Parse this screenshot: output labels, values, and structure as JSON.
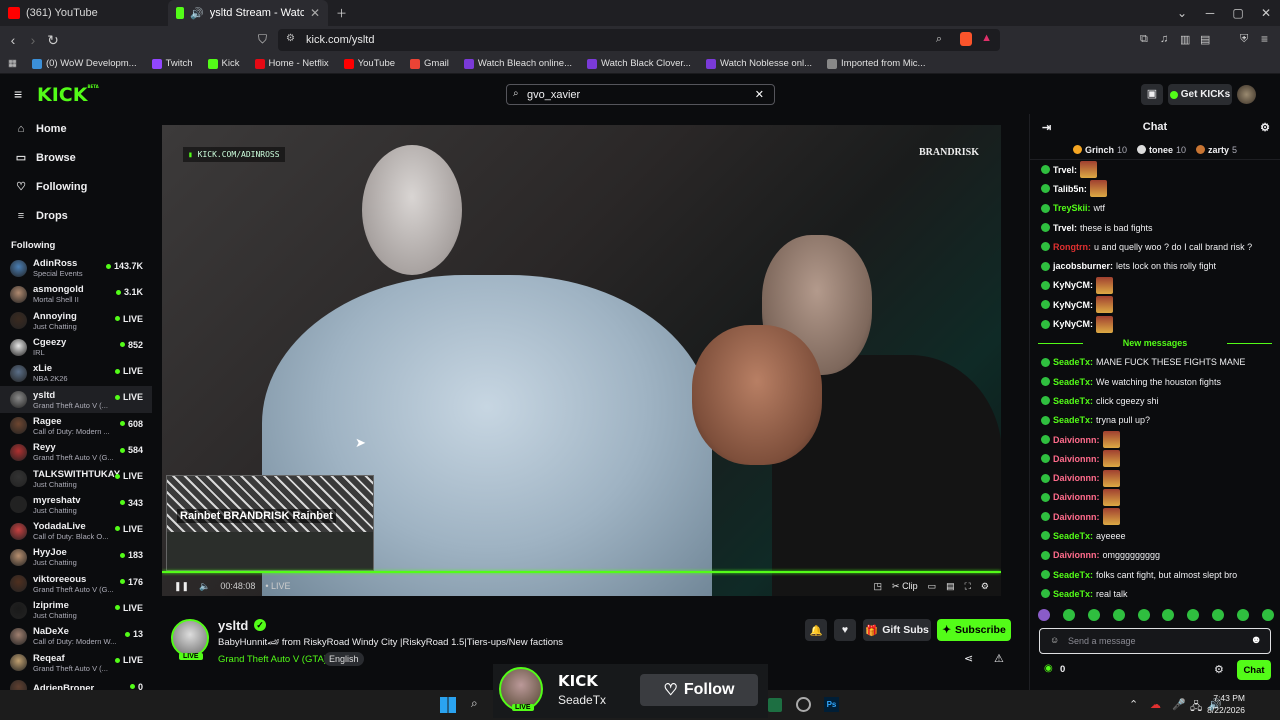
{
  "browser": {
    "tabs": [
      {
        "label": "(361) YouTube",
        "color": "#ff0000"
      },
      {
        "label": "ysltd Stream - Watch Live on",
        "color": "#53fc18"
      }
    ],
    "url": "kick.com/ysltd",
    "bookmarks": [
      {
        "label": "(0) WoW Developm...",
        "color": "#3b8fd8"
      },
      {
        "label": "Twitch",
        "color": "#9146ff"
      },
      {
        "label": "Kick",
        "color": "#53fc18"
      },
      {
        "label": "Home - Netflix",
        "color": "#e50914"
      },
      {
        "label": "YouTube",
        "color": "#ff0000"
      },
      {
        "label": "Gmail",
        "color": "#ea4335"
      },
      {
        "label": "Watch Bleach online...",
        "color": "#7a3ad8"
      },
      {
        "label": "Watch Black Clover...",
        "color": "#7a3ad8"
      },
      {
        "label": "Watch Noblesse onl...",
        "color": "#7a3ad8"
      },
      {
        "label": "Imported from Mic...",
        "color": "#888888"
      }
    ]
  },
  "header": {
    "logo": "KICK",
    "logo_sup": "BETA",
    "search_value": "gvo_xavier",
    "get_kicks": "Get KICKs"
  },
  "sidebar": {
    "nav": [
      {
        "label": "Home",
        "icon": "⌂"
      },
      {
        "label": "Browse",
        "icon": "▭"
      },
      {
        "label": "Following",
        "icon": "♡"
      },
      {
        "label": "Drops",
        "icon": "≡"
      }
    ],
    "following_title": "Following",
    "channels": [
      {
        "name": "AdinRoss",
        "cat": "Special Events",
        "count": "143.7K",
        "color": "#4a7fb5"
      },
      {
        "name": "asmongold",
        "cat": "Mortal Shell II",
        "count": "3.1K",
        "color": "#b08a70"
      },
      {
        "name": "Annoying",
        "cat": "Just Chatting",
        "count": "LIVE",
        "color": "#3a2a20"
      },
      {
        "name": "Cgeezy",
        "cat": "IRL",
        "count": "852",
        "color": "#e8e8e8"
      },
      {
        "name": "xLie",
        "cat": "NBA 2K26",
        "count": "LIVE",
        "color": "#5b6f88"
      },
      {
        "name": "ysltd",
        "cat": "Grand Theft Auto V (...",
        "count": "LIVE",
        "color": "#8b8b8b"
      },
      {
        "name": "Ragee",
        "cat": "Call of Duty: Modern ...",
        "count": "608",
        "color": "#6e4630"
      },
      {
        "name": "Reyy",
        "cat": "Grand Theft Auto V (G...",
        "count": "584",
        "color": "#b03030"
      },
      {
        "name": "TALKSWITHTUKAY",
        "cat": "Just Chatting",
        "count": "LIVE",
        "color": "#333333"
      },
      {
        "name": "myreshatv",
        "cat": "Just Chatting",
        "count": "343",
        "color": "#222222"
      },
      {
        "name": "YodadaLive",
        "cat": "Call of Duty: Black O...",
        "count": "LIVE",
        "color": "#c84040"
      },
      {
        "name": "HyyJoe",
        "cat": "Just Chatting",
        "count": "183",
        "color": "#b89070"
      },
      {
        "name": "viktoreeous",
        "cat": "Grand Theft Auto V (G...",
        "count": "176",
        "color": "#503020"
      },
      {
        "name": "lziprime",
        "cat": "Just Chatting",
        "count": "LIVE",
        "color": "#1a1a1a"
      },
      {
        "name": "NaDeXe",
        "cat": "Call of Duty: Modern W...",
        "count": "13",
        "color": "#a08070"
      },
      {
        "name": "Reqeaf",
        "cat": "Grand Theft Auto V (...",
        "count": "LIVE",
        "color": "#c0a070"
      },
      {
        "name": "AdrienBroner",
        "cat": "",
        "count": "0",
        "color": "#604030"
      }
    ]
  },
  "video": {
    "badge": "KICK.COM/ADINROSS",
    "brand": "BRANDRISK",
    "pip_text": "Rainbet BRANDRISK Rainbet",
    "time": "00:48:08",
    "live": "LIVE",
    "progress": 1.0
  },
  "stream": {
    "channel": "ysltd",
    "title": "BabyHunnit🏎 from RiskyRoad Windy City |RiskyRoad 1.5|Tiers-ups/New factions",
    "category": "Grand Theft Auto V (GTA)",
    "language": "English",
    "live": "LIVE",
    "gift_subs": "Gift Subs",
    "subscribe": "Subscribe"
  },
  "chat": {
    "title": "Chat",
    "top_gifters": [
      {
        "name": "Grinch",
        "count": "10",
        "color": "#f5a623"
      },
      {
        "name": "tonee",
        "count": "10",
        "color": "#dddddd"
      },
      {
        "name": "zarty",
        "count": "5",
        "color": "#c87533"
      }
    ],
    "messages": [
      {
        "user": "Trvel:",
        "text": "",
        "color": "#ffffff",
        "emote": true
      },
      {
        "user": "Talib5n:",
        "text": "",
        "color": "#ffffff",
        "emote": true
      },
      {
        "user": "TreySkii:",
        "text": "wtf",
        "color": "#53fc18",
        "emote": false
      },
      {
        "user": "Trvel:",
        "text": "these is bad fights",
        "color": "#ffffff",
        "emote": false
      },
      {
        "user": "Rongtrn:",
        "text": "u and quelly woo ? do I call brand risk ?",
        "color": "#e03030",
        "emote": false
      },
      {
        "user": "jacobsburner:",
        "text": "lets lock on this rolly fight",
        "color": "#ffffff",
        "emote": false
      },
      {
        "user": "KyNyCM:",
        "text": "",
        "color": "#ffffff",
        "emote": true
      },
      {
        "user": "KyNyCM:",
        "text": "",
        "color": "#ffffff",
        "emote": true
      },
      {
        "user": "KyNyCM:",
        "text": "",
        "color": "#ffffff",
        "emote": true
      }
    ],
    "new_messages_label": "New messages",
    "messages2": [
      {
        "user": "SeadeTx:",
        "text": "MANE FUCK THESE FIGHTS MANE",
        "color": "#53fc18",
        "emote": false
      },
      {
        "user": "SeadeTx:",
        "text": "We watching the houston fights",
        "color": "#53fc18",
        "emote": false
      },
      {
        "user": "SeadeTx:",
        "text": "click cgeezy shi",
        "color": "#53fc18",
        "emote": false
      },
      {
        "user": "SeadeTx:",
        "text": "tryna pull up?",
        "color": "#53fc18",
        "emote": false
      },
      {
        "user": "Daivionnn:",
        "text": "",
        "color": "#ff6b8b",
        "emote": true
      },
      {
        "user": "Daivionnn:",
        "text": "",
        "color": "#ff6b8b",
        "emote": true
      },
      {
        "user": "Daivionnn:",
        "text": "",
        "color": "#ff6b8b",
        "emote": true
      },
      {
        "user": "Daivionnn:",
        "text": "",
        "color": "#ff6b8b",
        "emote": true
      },
      {
        "user": "Daivionnn:",
        "text": "",
        "color": "#ff6b8b",
        "emote": true
      },
      {
        "user": "SeadeTx:",
        "text": "ayeeee",
        "color": "#53fc18",
        "emote": false
      },
      {
        "user": "Daivionnn:",
        "text": "omggggggggg",
        "color": "#ff6b8b",
        "emote": false
      },
      {
        "user": "SeadeTx:",
        "text": "folks cant fight, but almost slept bro",
        "color": "#53fc18",
        "emote": false
      },
      {
        "user": "SeadeTx:",
        "text": "real talk",
        "color": "#53fc18",
        "emote": false
      }
    ],
    "input_placeholder": "Send a message",
    "points": "0",
    "send_label": "Chat"
  },
  "popup": {
    "kick": "KICK",
    "user": "SeadeTx",
    "live": "LIVE",
    "follow": "Follow"
  },
  "taskbar": {
    "time": "7:43 PM",
    "date": "8/22/2026"
  }
}
